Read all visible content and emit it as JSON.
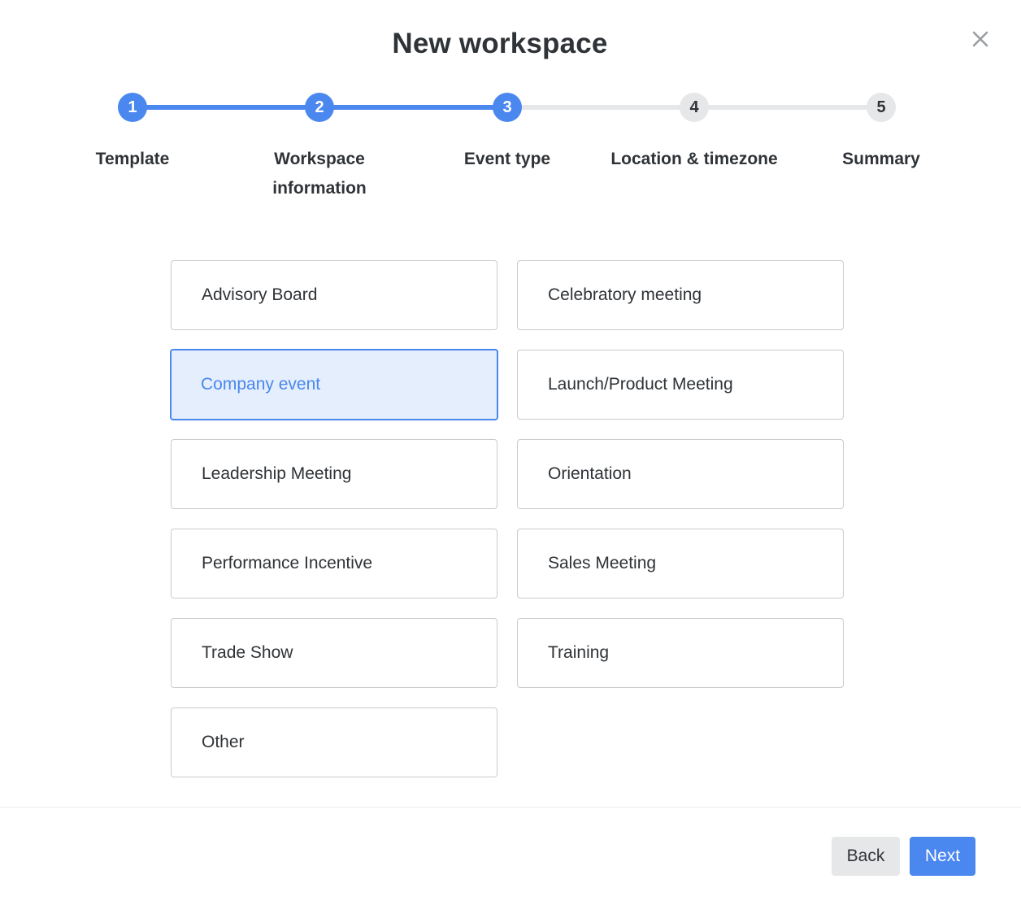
{
  "dialog": {
    "title": "New workspace",
    "close_icon": "close-icon"
  },
  "stepper": {
    "current_step": 3,
    "steps": [
      {
        "number": "1",
        "label": "Template",
        "state": "done"
      },
      {
        "number": "2",
        "label": "Workspace information",
        "state": "done"
      },
      {
        "number": "3",
        "label": "Event type",
        "state": "current"
      },
      {
        "number": "4",
        "label": "Location & timezone",
        "state": "todo"
      },
      {
        "number": "5",
        "label": "Summary",
        "state": "todo"
      }
    ]
  },
  "event_types": {
    "selected": "Company event",
    "options": [
      "Advisory Board",
      "Celebratory meeting",
      "Company event",
      "Launch/Product Meeting",
      "Leadership Meeting",
      "Orientation",
      "Performance Incentive",
      "Sales Meeting",
      "Trade Show",
      "Training",
      "Other"
    ]
  },
  "footer": {
    "back_label": "Back",
    "next_label": "Next"
  },
  "colors": {
    "accent": "#4a87ee",
    "accent_light": "#e4eefc",
    "inactive": "#e6e7e8",
    "text": "#2f3337",
    "border": "#c9cbce"
  }
}
